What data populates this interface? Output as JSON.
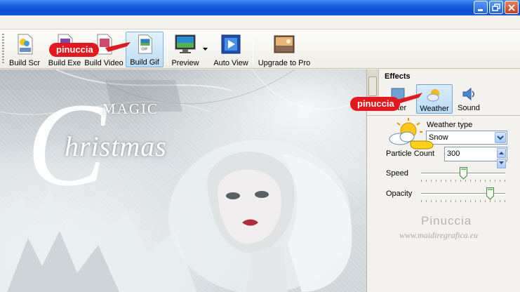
{
  "toolbar": {
    "buttons": [
      {
        "label": "Build Scr",
        "icon": "scr-file-icon"
      },
      {
        "label": "Build Exe",
        "icon": "exe-file-icon"
      },
      {
        "label": "Build Video",
        "icon": "video-file-icon"
      },
      {
        "label": "Build Gif",
        "icon": "gif-file-icon"
      },
      {
        "label": "Preview",
        "icon": "monitor-icon"
      },
      {
        "label": "Auto View",
        "icon": "film-icon"
      },
      {
        "label": "Upgrade to Pro",
        "icon": "picture-icon"
      }
    ],
    "active": "Build Gif"
  },
  "preview": {
    "magic": "MAGIC",
    "christmas": "hristmas",
    "initial": "C"
  },
  "effects": {
    "title": "Effects",
    "tabs": [
      {
        "label": "Filter",
        "icon": "filter-icon"
      },
      {
        "label": "Weather",
        "icon": "weather-icon"
      },
      {
        "label": "Sound",
        "icon": "speaker-icon"
      }
    ],
    "active_tab": "Weather",
    "weather_type_label": "Weather type",
    "weather_type_value": "Snow",
    "particle_count_label": "Particle Count",
    "particle_count_value": "300",
    "speed_label": "Speed",
    "speed_level": 0.5,
    "opacity_label": "Opacity",
    "opacity_level": 0.85
  },
  "annotations": {
    "tag1": "pinuccia",
    "tag2": "pinuccia"
  },
  "watermark": {
    "name": "Pinuccia",
    "url": "www.maidiregrafica.eu"
  },
  "colors": {
    "titlebar": "#0a4fd6",
    "tag": "#e5161c",
    "active_bg": "#bcdcf3"
  }
}
